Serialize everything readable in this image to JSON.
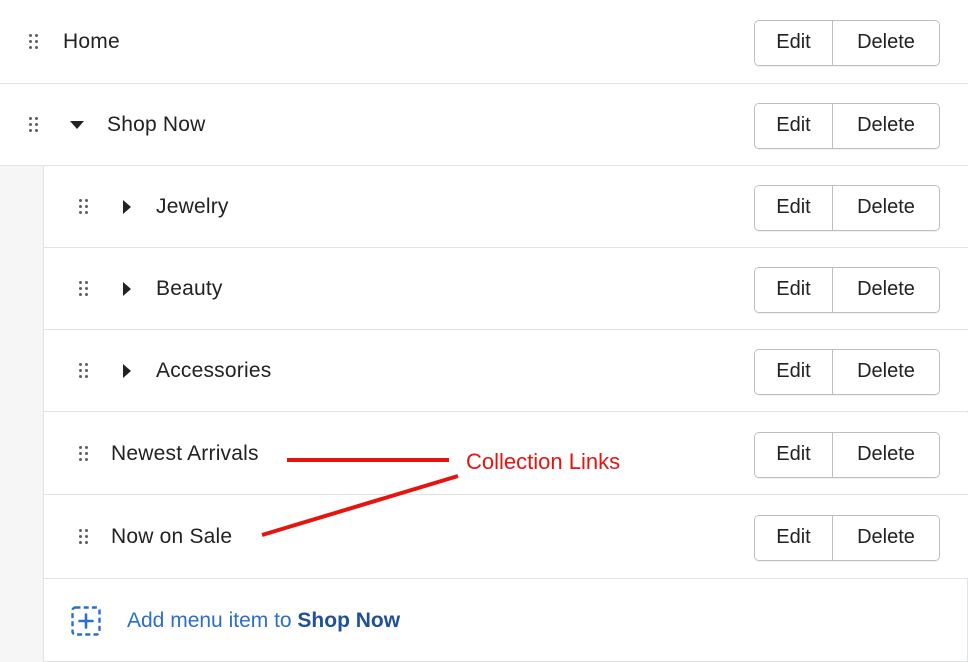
{
  "menu": {
    "items": [
      {
        "label": "Home",
        "toggle": "none"
      },
      {
        "label": "Shop Now",
        "toggle": "expanded"
      },
      {
        "label": "Jewelry",
        "toggle": "collapsed"
      },
      {
        "label": "Beauty",
        "toggle": "collapsed"
      },
      {
        "label": "Accessories",
        "toggle": "collapsed"
      },
      {
        "label": "Newest Arrivals",
        "toggle": "none"
      },
      {
        "label": "Now on Sale",
        "toggle": "none"
      }
    ],
    "edit_label": "Edit",
    "delete_label": "Delete",
    "add_item": {
      "prefix": "Add menu item to ",
      "target": "Shop Now"
    }
  },
  "annotation": {
    "text": "Collection Links",
    "color": "#e5140f"
  },
  "icons": {
    "drag": "drag-handle-icon",
    "expanded": "caret-down-icon",
    "collapsed": "caret-right-icon",
    "add": "add-square-icon"
  },
  "colors": {
    "link": "#2c6ecb",
    "border": "#babfc3",
    "indent_bg": "#f6f6f7"
  }
}
